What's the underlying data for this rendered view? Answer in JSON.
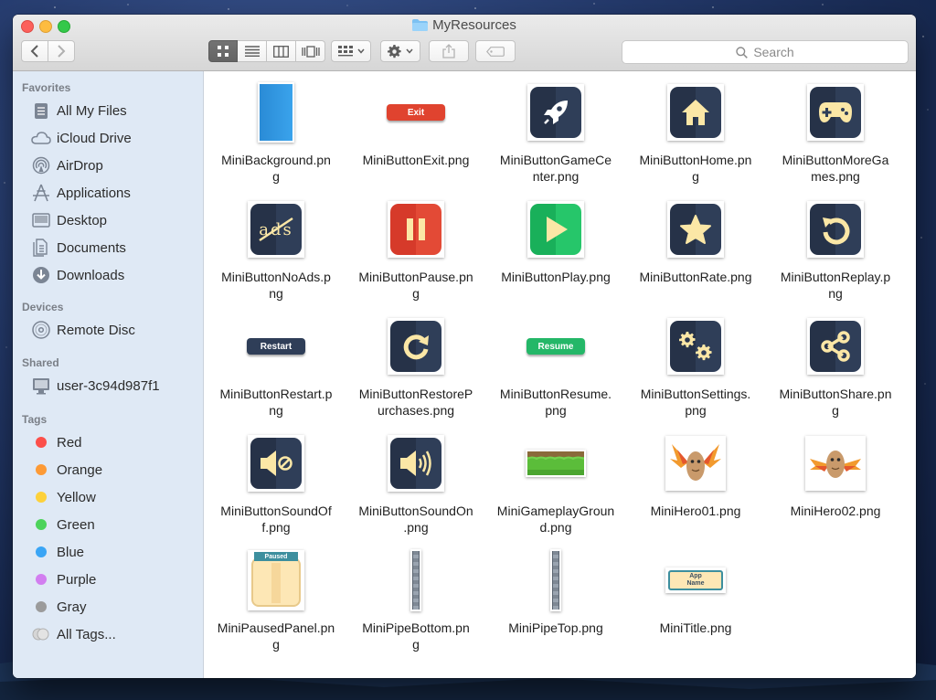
{
  "window": {
    "title": "MyResources"
  },
  "toolbar": {
    "search_placeholder": "Search"
  },
  "sidebar": {
    "favorites_header": "Favorites",
    "favorites": [
      {
        "label": "All My Files",
        "icon": "all-files-icon"
      },
      {
        "label": "iCloud Drive",
        "icon": "cloud-icon"
      },
      {
        "label": "AirDrop",
        "icon": "airdrop-icon"
      },
      {
        "label": "Applications",
        "icon": "applications-icon"
      },
      {
        "label": "Desktop",
        "icon": "desktop-icon"
      },
      {
        "label": "Documents",
        "icon": "documents-icon"
      },
      {
        "label": "Downloads",
        "icon": "downloads-icon"
      }
    ],
    "devices_header": "Devices",
    "devices": [
      {
        "label": "Remote Disc",
        "icon": "disc-icon"
      }
    ],
    "shared_header": "Shared",
    "shared": [
      {
        "label": "user-3c94d987f1",
        "icon": "computer-icon"
      }
    ],
    "tags_header": "Tags",
    "tags": [
      {
        "label": "Red",
        "color": "#fc4f4a"
      },
      {
        "label": "Orange",
        "color": "#fd9a35"
      },
      {
        "label": "Yellow",
        "color": "#fdd13a"
      },
      {
        "label": "Green",
        "color": "#4cd35b"
      },
      {
        "label": "Blue",
        "color": "#3aa5f5"
      },
      {
        "label": "Purple",
        "color": "#d27ef0"
      },
      {
        "label": "Gray",
        "color": "#9b9b9b"
      },
      {
        "label": "All Tags...",
        "color": "#c8c8c8"
      }
    ]
  },
  "files": [
    {
      "name": "MiniBackground.png",
      "line1": "MiniBackground.pn",
      "line2": "g"
    },
    {
      "name": "MiniButtonExit.png",
      "line1": "MiniButtonExit.png",
      "line2": "",
      "label": "Exit"
    },
    {
      "name": "MiniButtonGameCenter.png",
      "line1": "MiniButtonGameCe",
      "line2": "nter.png"
    },
    {
      "name": "MiniButtonHome.png",
      "line1": "MiniButtonHome.pn",
      "line2": "g"
    },
    {
      "name": "MiniButtonMoreGames.png",
      "line1": "MiniButtonMoreGa",
      "line2": "mes.png"
    },
    {
      "name": "MiniButtonNoAds.png",
      "line1": "MiniButtonNoAds.p",
      "line2": "ng",
      "label": "ads"
    },
    {
      "name": "MiniButtonPause.png",
      "line1": "MiniButtonPause.pn",
      "line2": "g"
    },
    {
      "name": "MiniButtonPlay.png",
      "line1": "MiniButtonPlay.png",
      "line2": ""
    },
    {
      "name": "MiniButtonRate.png",
      "line1": "MiniButtonRate.png",
      "line2": ""
    },
    {
      "name": "MiniButtonReplay.png",
      "line1": "MiniButtonReplay.p",
      "line2": "ng"
    },
    {
      "name": "MiniButtonRestart.png",
      "line1": "MiniButtonRestart.p",
      "line2": "ng",
      "label": "Restart"
    },
    {
      "name": "MiniButtonRestorePurchases.png",
      "line1": "MiniButtonRestoreP",
      "line2": "urchases.png"
    },
    {
      "name": "MiniButtonResume.png",
      "line1": "MiniButtonResume.",
      "line2": "png",
      "label": "Resume"
    },
    {
      "name": "MiniButtonSettings.png",
      "line1": "MiniButtonSettings.",
      "line2": "png"
    },
    {
      "name": "MiniButtonShare.png",
      "line1": "MiniButtonShare.pn",
      "line2": "g"
    },
    {
      "name": "MiniButtonSoundOff.png",
      "line1": "MiniButtonSoundOf",
      "line2": "f.png"
    },
    {
      "name": "MiniButtonSoundOn.png",
      "line1": "MiniButtonSoundOn",
      "line2": ".png"
    },
    {
      "name": "MiniGameplayGround.png",
      "line1": "MiniGameplayGroun",
      "line2": "d.png"
    },
    {
      "name": "MiniHero01.png",
      "line1": "MiniHero01.png",
      "line2": ""
    },
    {
      "name": "MiniHero02.png",
      "line1": "MiniHero02.png",
      "line2": ""
    },
    {
      "name": "MiniPausedPanel.png",
      "line1": "MiniPausedPanel.pn",
      "line2": "g",
      "label": "Paused"
    },
    {
      "name": "MiniPipeBottom.png",
      "line1": "MiniPipeBottom.pn",
      "line2": "g"
    },
    {
      "name": "MiniPipeTop.png",
      "line1": "MiniPipeTop.png",
      "line2": ""
    },
    {
      "name": "MiniTitle.png",
      "line1": "MiniTitle.png",
      "line2": "",
      "label": "App Name"
    }
  ]
}
